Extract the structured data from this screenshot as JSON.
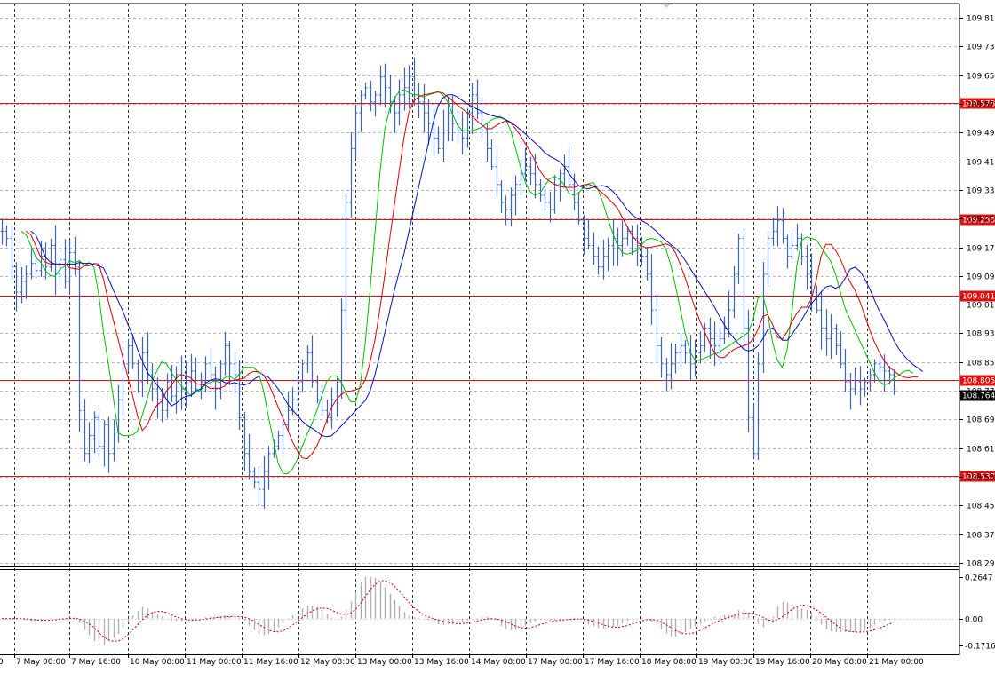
{
  "colors": {
    "background": "#ffffff",
    "grid": "#a0a0a0",
    "bar": "#3a62c8",
    "level": "#e01010",
    "ma_fast": "#00c000",
    "ma_mid": "#e00000",
    "ma_slow": "#0010c0",
    "current_bg": "#000000",
    "level_bg": "#e01010",
    "osc_hist": "#b0b0b0",
    "osc_signal": "#c00000"
  },
  "chart_data": [
    {
      "type": "ohlc-bar",
      "title": "",
      "price_axis": {
        "ylim": [
          108.27,
          109.84
        ],
        "ticks": [
          "109.815",
          "109.735",
          "109.655",
          "109.575",
          "109.495",
          "109.415",
          "109.335",
          "109.255",
          "109.175",
          "109.095",
          "109.015",
          "108.935",
          "108.855",
          "108.775",
          "108.695",
          "108.615",
          "108.535",
          "108.455",
          "108.375",
          "108.295"
        ]
      },
      "time_axis": {
        "labels": [
          "0",
          "7 May 00:00",
          "7 May 16:00",
          "10 May 08:00",
          "11 May 00:00",
          "11 May 16:00",
          "12 May 08:00",
          "13 May 00:00",
          "13 May 16:00",
          "14 May 08:00",
          "17 May 00:00",
          "17 May 16:00",
          "18 May 08:00",
          "19 May 00:00",
          "19 May 16:00",
          "20 May 08:00",
          "21 May 00:00"
        ]
      },
      "levels": [
        {
          "value": 109.578,
          "label": "109.578"
        },
        {
          "value": 109.253,
          "label": "109.253"
        },
        {
          "value": 109.041,
          "label": "109.041"
        },
        {
          "value": 108.805,
          "label": "108.805"
        },
        {
          "value": 108.537,
          "label": "108.537"
        }
      ],
      "current_price": {
        "value": 108.764,
        "label": "108.764"
      },
      "closes": [
        109.22,
        109.2,
        109.12,
        109.05,
        109.08,
        109.1,
        109.13,
        109.11,
        109.15,
        109.12,
        109.18,
        109.1,
        109.14,
        109.08,
        109.16,
        109.12,
        108.72,
        108.6,
        108.65,
        108.7,
        108.62,
        108.68,
        108.6,
        108.66,
        108.75,
        108.85,
        108.9,
        108.85,
        108.8,
        108.88,
        108.82,
        108.78,
        108.75,
        108.72,
        108.8,
        108.76,
        108.82,
        108.78,
        108.8,
        108.83,
        108.78,
        108.8,
        108.85,
        108.82,
        108.78,
        108.85,
        108.9,
        108.85,
        108.82,
        108.7,
        108.6,
        108.55,
        108.52,
        108.5,
        108.55,
        108.6,
        108.62,
        108.65,
        108.68,
        108.72,
        108.75,
        108.8,
        108.85,
        108.88,
        108.8,
        108.75,
        108.72,
        108.7,
        108.75,
        108.8,
        109.0,
        109.3,
        109.45,
        109.55,
        109.6,
        109.62,
        109.58,
        109.6,
        109.65,
        109.62,
        109.58,
        109.55,
        109.6,
        109.62,
        109.65,
        109.6,
        109.58,
        109.55,
        109.52,
        109.48,
        109.45,
        109.5,
        109.55,
        109.52,
        109.5,
        109.48,
        109.55,
        109.6,
        109.55,
        109.5,
        109.45,
        109.4,
        109.35,
        109.3,
        109.28,
        109.32,
        109.35,
        109.38,
        109.4,
        109.38,
        109.35,
        109.32,
        109.3,
        109.28,
        109.35,
        109.38,
        109.4,
        109.35,
        109.3,
        109.25,
        109.2,
        109.18,
        109.15,
        109.12,
        109.15,
        109.18,
        109.2,
        109.18,
        109.2,
        109.22,
        109.2,
        109.18,
        109.15,
        109.1,
        109.0,
        108.9,
        108.85,
        108.82,
        108.85,
        108.88,
        108.9,
        108.88,
        108.85,
        108.88,
        108.9,
        108.95,
        108.92,
        108.9,
        108.92,
        108.95,
        109.0,
        109.1,
        109.2,
        108.95,
        108.7,
        108.6,
        108.85,
        109.1,
        109.2,
        109.22,
        109.25,
        109.2,
        109.15,
        109.18,
        109.2,
        109.15,
        109.1,
        109.05,
        109.0,
        108.95,
        108.92,
        108.95,
        108.9,
        108.85,
        108.8,
        108.78,
        108.8,
        108.78,
        108.8,
        108.82,
        108.85,
        108.84,
        108.83,
        108.82,
        108.78
      ]
    },
    {
      "type": "oscillator",
      "title": "",
      "ticks": [
        "0.2647",
        "0.00",
        "-0.1716"
      ],
      "ylim": [
        -0.1716,
        0.2647
      ]
    }
  ]
}
